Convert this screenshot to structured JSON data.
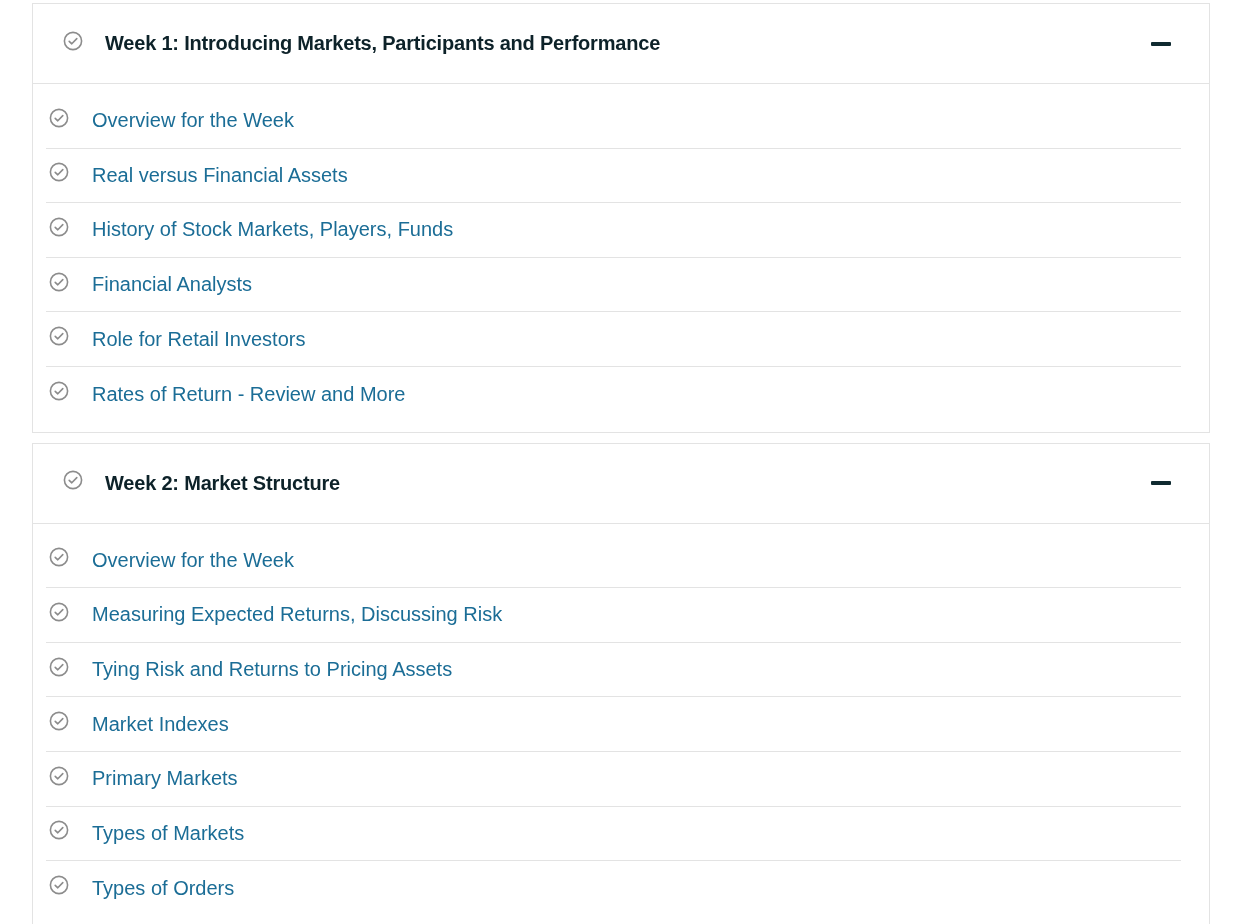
{
  "weeks": [
    {
      "title": "Week 1: Introducing Markets, Participants and Performance",
      "expanded": true,
      "items": [
        "Overview for the Week",
        "Real versus Financial Assets",
        "History of Stock Markets, Players, Funds",
        "Financial Analysts",
        "Role for Retail Investors",
        "Rates of Return - Review and More"
      ]
    },
    {
      "title": "Week 2: Market Structure",
      "expanded": true,
      "items": [
        "Overview for the Week",
        "Measuring Expected Returns, Discussing Risk",
        "Tying Risk and Returns to Pricing Assets",
        "Market Indexes",
        "Primary Markets",
        "Types of Markets",
        "Types of Orders"
      ]
    }
  ]
}
